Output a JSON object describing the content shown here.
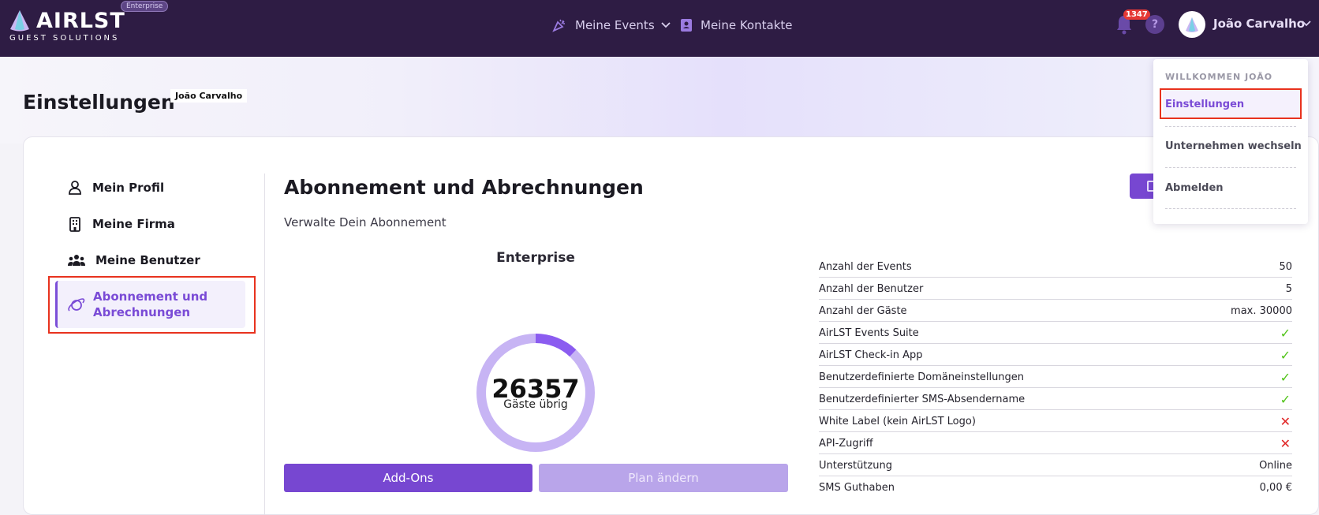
{
  "header": {
    "logo_text": "AIRLST",
    "logo_subtitle": "GUEST SOLUTIONS",
    "plan_badge": "Enterprise",
    "nav": [
      {
        "label": "Meine Events",
        "icon": "party-popper-icon",
        "has_dropdown": true
      },
      {
        "label": "Meine Kontakte",
        "icon": "contact-book-icon",
        "has_dropdown": false
      }
    ],
    "notification_count": "1347",
    "help_label": "?",
    "user_name": "João Carvalho"
  },
  "page": {
    "title": "Einstellungen",
    "owner_badge": "João Carvalho"
  },
  "sidebar": {
    "items": [
      {
        "label": "Mein Profil",
        "icon": "user-icon"
      },
      {
        "label": "Meine Firma",
        "icon": "building-icon"
      },
      {
        "label": "Meine Benutzer",
        "icon": "users-icon"
      },
      {
        "label": "Abonnement und Abrechnungen",
        "icon": "planet-icon",
        "active": true
      }
    ]
  },
  "main": {
    "title": "Abonnement und Abrechnungen",
    "subtitle": "Verwalte Dein Abonnement",
    "plan_name": "Enterprise",
    "guests_remaining": "26357",
    "guests_remaining_label": "Gäste übrig",
    "guests_used_fraction": 0.12,
    "buttons": {
      "addons": "Add-Ons",
      "change_plan": "Plan ändern"
    },
    "features": [
      {
        "label": "Anzahl der Events",
        "value": "50"
      },
      {
        "label": "Anzahl der Benutzer",
        "value": "5"
      },
      {
        "label": "Anzahl der Gäste",
        "value": "max. 30000"
      },
      {
        "label": "AirLST Events Suite",
        "status": "check"
      },
      {
        "label": "AirLST Check-in App",
        "status": "check"
      },
      {
        "label": "Benutzerdefinierte Domäneinstellungen",
        "status": "check"
      },
      {
        "label": "Benutzerdefinierter SMS-Absendername",
        "status": "check"
      },
      {
        "label": "White Label (kein AirLST Logo)",
        "status": "cross"
      },
      {
        "label": "API-Zugriff",
        "status": "cross"
      },
      {
        "label": "Unterstützung",
        "value": "Online"
      },
      {
        "label": "SMS Guthaben",
        "value": "0,00 €"
      }
    ]
  },
  "user_menu": {
    "greeting": "WILLKOMMEN JOÃO",
    "items": [
      {
        "label": "Einstellungen",
        "active": true
      },
      {
        "label": "Unternehmen wechseln"
      },
      {
        "label": "Abmelden"
      }
    ]
  },
  "colors": {
    "topbar": "#2e1c44",
    "accent": "#7747d1",
    "accent_light": "#b9a5ea",
    "donut_used": "#8b5cf0",
    "donut_remaining": "#c7b4f4",
    "check": "#52c41a",
    "cross": "#e02424",
    "highlight": "#e8321e"
  }
}
